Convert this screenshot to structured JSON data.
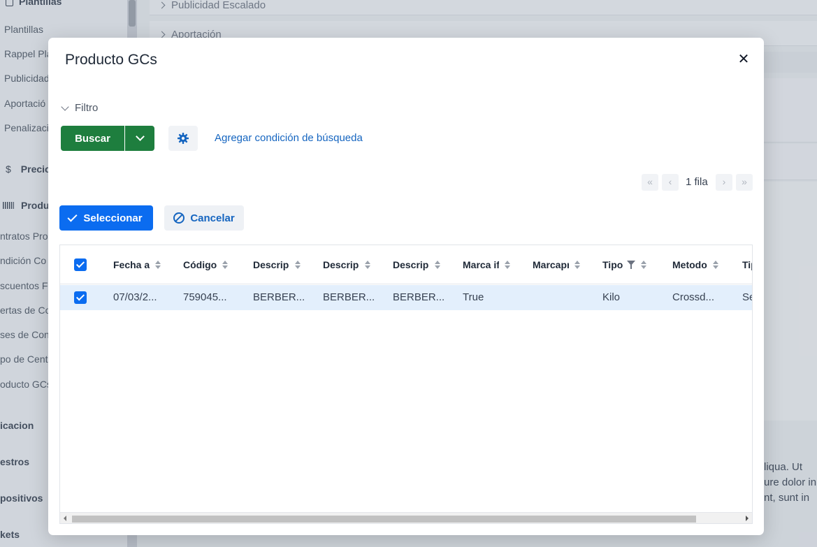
{
  "background": {
    "sidebar": {
      "section_plantillas": "Plantillas",
      "items_top": [
        "Plantillas",
        "Rappel Pla",
        "Publicidad",
        "Aportació",
        "Penalizaci"
      ],
      "section_precio": "Precio",
      "section_producto": "Produ",
      "items_mid": [
        "ntratos Pro",
        "ndición Co",
        "scuentos Fu",
        "ertas de Co",
        "ses de Con",
        "po de Centr",
        "oducto GCs"
      ],
      "bottom_heads": [
        "icacion",
        "estros",
        "positivos",
        "kets"
      ]
    },
    "main": {
      "accordion_1": "Publicidad Escalado",
      "accordion_2": "Aportación",
      "lorem_lines": [
        "liqua. Ut",
        "ure dolor in",
        "nt, sunt in"
      ]
    }
  },
  "modal": {
    "title": "Producto GCs",
    "filter_label": "Filtro",
    "buscar_label": "Buscar",
    "add_condition_label": "Agregar condición de búsqueda",
    "pager": {
      "first": "«",
      "prev": "‹",
      "text": "1 fila",
      "next": "›",
      "last": "»"
    },
    "select_label": "Seleccionar",
    "cancel_label": "Cancelar",
    "grid": {
      "columns": [
        "Fecha al",
        "Código",
        "Descripc",
        "Descripc",
        "Descripc",
        "Marca if",
        "Marcapr",
        "Tipo",
        "Metodo",
        "Tip"
      ],
      "rows": [
        [
          "07/03/2...",
          "759045...",
          "BERBER...",
          "BERBER...",
          "BERBER...",
          "True",
          "",
          "Kilo",
          "Crossd...",
          "Se"
        ]
      ]
    }
  }
}
